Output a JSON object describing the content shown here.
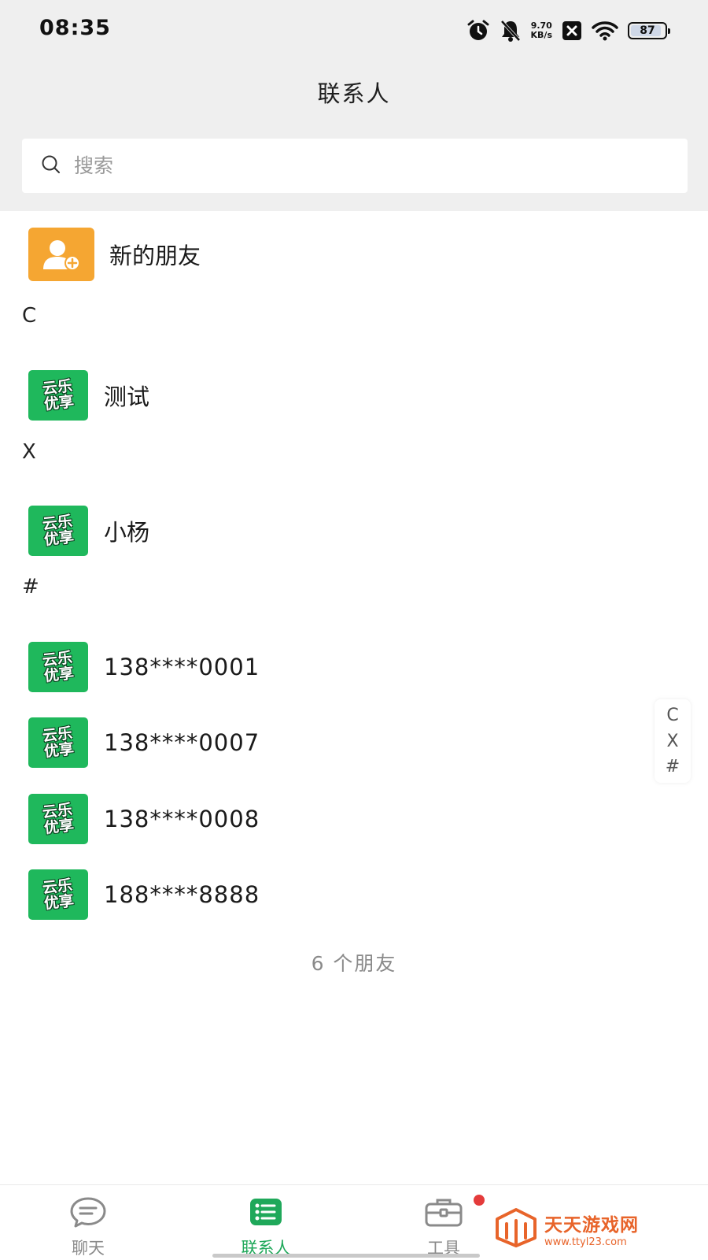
{
  "status_bar": {
    "time": "08:35",
    "net_speed_value": "9.70",
    "net_speed_unit": "KB/s",
    "battery": "87",
    "icons": [
      "alarm-icon",
      "mute-bell-icon",
      "close-box-icon",
      "wifi-icon",
      "battery-icon"
    ]
  },
  "header": {
    "title": "联系人"
  },
  "search": {
    "placeholder": "搜索"
  },
  "new_friend": {
    "label": "新的朋友"
  },
  "sections": [
    {
      "letter": "C",
      "contacts": [
        {
          "name": "测试"
        }
      ]
    },
    {
      "letter": "X",
      "contacts": [
        {
          "name": "小杨"
        }
      ]
    },
    {
      "letter": "#",
      "contacts": [
        {
          "name": "138****0001"
        },
        {
          "name": "138****0007"
        },
        {
          "name": "138****0008"
        },
        {
          "name": "188****8888"
        }
      ]
    }
  ],
  "avatar_text": {
    "line1": "云乐",
    "line2": "优享"
  },
  "footer": {
    "count_text": "6 个朋友"
  },
  "index_bar": [
    "C",
    "X",
    "#"
  ],
  "tabbar": {
    "tabs": [
      {
        "label": "聊天",
        "icon": "chat-bubble-icon",
        "active": false
      },
      {
        "label": "联系人",
        "icon": "contacts-list-icon",
        "active": true
      },
      {
        "label": "工具",
        "icon": "toolbox-icon",
        "active": false,
        "badge": true
      }
    ]
  },
  "watermark": {
    "title": "天天游戏网",
    "url": "www.ttyl23.com"
  },
  "colors": {
    "accent": "#1fa85a",
    "avatar_green": "#1fb85c",
    "new_friend_orange": "#f5a632",
    "header_bg": "#efefef",
    "badge_red": "#e43b3b",
    "watermark_orange": "#e8642a"
  }
}
